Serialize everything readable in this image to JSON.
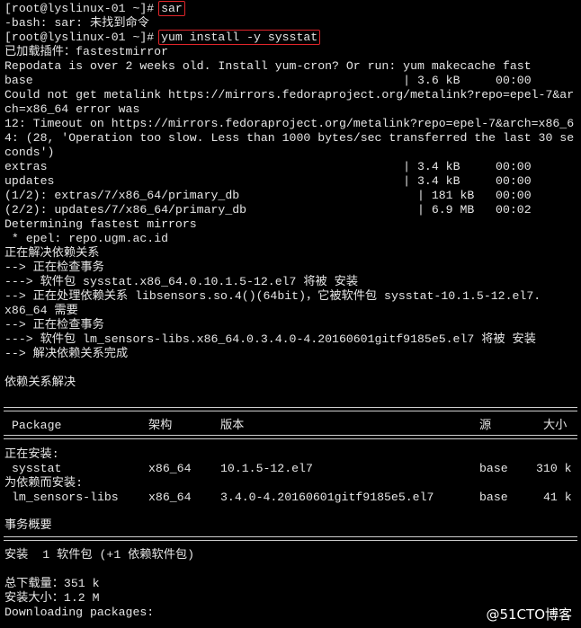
{
  "terminal": {
    "background": "#000000",
    "foreground": "#e6e6e6",
    "highlight_color": "#e0252a",
    "prompt1": "[root@lyslinux-01 ~]# ",
    "cmd1": "sar",
    "err": "-bash: sar: 未找到命令",
    "prompt2": "[root@lyslinux-01 ~]# ",
    "cmd2": "yum install -y sysstat",
    "lines": [
      "已加载插件：fastestmirror",
      "Repodata is over 2 weeks old. Install yum-cron? Or run: yum makecache fast",
      "base                                                    | 3.6 kB     00:00",
      "Could not get metalink https://mirrors.fedoraproject.org/metalink?repo=epel-7&ar",
      "ch=x86_64 error was",
      "12: Timeout on https://mirrors.fedoraproject.org/metalink?repo=epel-7&arch=x86_6",
      "4: (28, 'Operation too slow. Less than 1000 bytes/sec transferred the last 30 se",
      "conds')",
      "extras                                                  | 3.4 kB     00:00",
      "updates                                                 | 3.4 kB     00:00",
      "(1/2): extras/7/x86_64/primary_db                         | 181 kB   00:00",
      "(2/2): updates/7/x86_64/primary_db                        | 6.9 MB   00:02",
      "Determining fastest mirrors",
      " * epel: repo.ugm.ac.id",
      "正在解决依赖关系",
      "--> 正在检查事务",
      "---> 软件包 sysstat.x86_64.0.10.1.5-12.el7 将被 安装",
      "--> 正在处理依赖关系 libsensors.so.4()(64bit)，它被软件包 sysstat-10.1.5-12.el7.",
      "x86_64 需要",
      "--> 正在检查事务",
      "---> 软件包 lm_sensors-libs.x86_64.0.3.4.0-4.20160601gitf9185e5.el7 将被 安装",
      "--> 解决依赖关系完成",
      "",
      "依赖关系解决"
    ],
    "table": {
      "headers": {
        "package": "Package",
        "arch": "架构",
        "version": "版本",
        "repo": "源",
        "size": "大小"
      },
      "installing_label": "正在安装:",
      "dep_label": "为依赖而安装:",
      "rows": [
        {
          "package": "sysstat",
          "arch": "x86_64",
          "version": "10.1.5-12.el7",
          "repo": "base",
          "size": "310 k"
        },
        {
          "package": "lm_sensors-libs",
          "arch": "x86_64",
          "version": "3.4.0-4.20160601gitf9185e5.el7",
          "repo": "base",
          "size": "41 k"
        }
      ]
    },
    "summary_title": "事务概要",
    "install_summary": "安装  1 软件包 (+1 依赖软件包)",
    "total_download": "总下载量：351 k",
    "installed_size": "安装大小：1.2 M",
    "downloading": "Downloading packages:"
  },
  "watermark": "@51CTO博客"
}
